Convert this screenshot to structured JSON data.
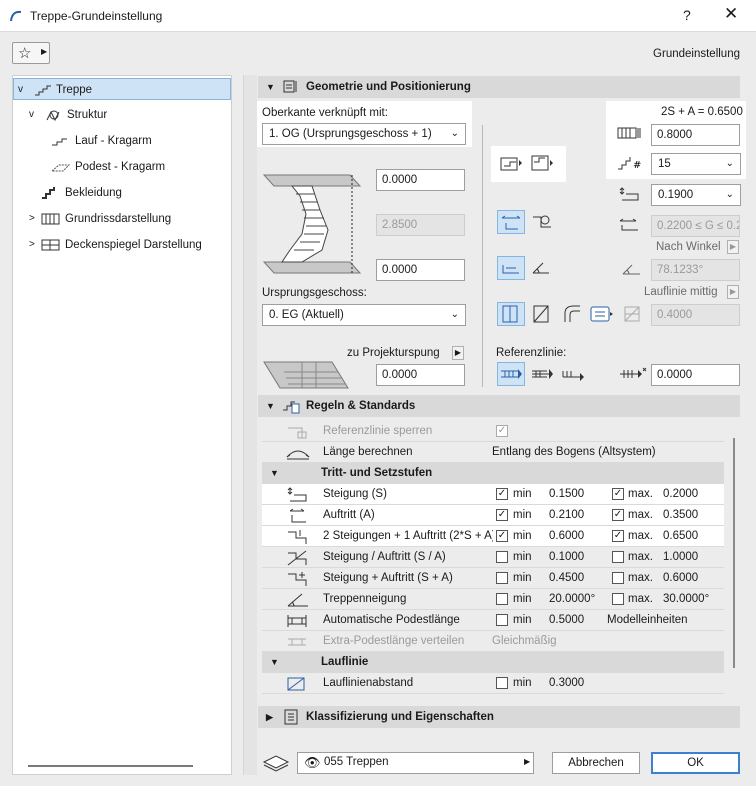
{
  "window": {
    "title": "Treppe-Grundeinstellung",
    "help": "?",
    "close": "✕"
  },
  "header": {
    "right_label": "Grundeinstellung"
  },
  "tree": [
    {
      "label": "Treppe",
      "expanded": "v",
      "icon": "stair-icon"
    },
    {
      "label": "Struktur",
      "expanded": "v",
      "icon": "structure-icon"
    },
    {
      "label": "Lauf - Kragarm",
      "icon": "flight-icon"
    },
    {
      "label": "Podest - Kragarm",
      "icon": "landing-icon"
    },
    {
      "label": "Bekleidung",
      "icon": "finish-icon"
    },
    {
      "label": "Grundrissdarstellung",
      "expanded": ">",
      "icon": "floorplan-icon"
    },
    {
      "label": "Deckenspiegel Darstellung",
      "expanded": ">",
      "icon": "ceiling-icon"
    }
  ],
  "geometry": {
    "title": "Geometrie und Positionierung",
    "top_link_label": "Oberkante verknüpft mit:",
    "top_link_value": "1. OG (Ursprungsgeschoss + 1)",
    "top_offset": "0.0000",
    "height": "2.8500",
    "bottom_offset": "0.0000",
    "home_story_label": "Ursprungsgeschoss:",
    "home_story_value": "0. EG (Aktuell)",
    "project_zero_label": "zu Projekturspung",
    "project_zero_value": "0.0000",
    "formula": "2S + A = 0.6500",
    "width": "0.8000",
    "num_risers": "15",
    "riser_height": "0.1900",
    "tread_range": "0.2200 ≤ G ≤ 0.2",
    "by_angle_label": "Nach Winkel",
    "angle": "78.1233°",
    "walkline_label": "Lauflinie mittig",
    "walkline_offset": "0.4000",
    "refline_label": "Referenzlinie:",
    "refline_offset": "0.0000"
  },
  "rules": {
    "title": "Regeln & Standards",
    "rows_top": [
      {
        "name": "Referenzlinie sperren",
        "checked": "✓",
        "disabled": true
      },
      {
        "name": "Länge berechnen",
        "value": "Entlang des Bogens (Altsystem)"
      }
    ],
    "subhead1": "Tritt- und Setzstufen",
    "rows": [
      {
        "name": "Steigung (S)",
        "cb1": "✓",
        "min_label": "min",
        "v1": "0.1500",
        "cb2": "✓",
        "max_label": "max.",
        "v2": "0.2000",
        "white": true
      },
      {
        "name": "Auftritt (A)",
        "cb1": "✓",
        "min_label": "min",
        "v1": "0.2100",
        "cb2": "✓",
        "max_label": "max.",
        "v2": "0.3500",
        "white": true
      },
      {
        "name": "2 Steigungen + 1 Auftritt (2*S + A)",
        "cb1": "✓",
        "min_label": "min",
        "v1": "0.6000",
        "cb2": "✓",
        "max_label": "max.",
        "v2": "0.6500",
        "white": true
      },
      {
        "name": "Steigung / Auftritt (S / A)",
        "cb1": "",
        "min_label": "min",
        "v1": "0.1000",
        "cb2": "",
        "max_label": "max.",
        "v2": "1.0000"
      },
      {
        "name": "Steigung + Auftritt (S + A)",
        "cb1": "",
        "min_label": "min",
        "v1": "0.4500",
        "cb2": "",
        "max_label": "max.",
        "v2": "0.6000"
      },
      {
        "name": "Treppenneigung",
        "cb1": "",
        "min_label": "min",
        "v1": "20.0000°",
        "cb2": "",
        "max_label": "max.",
        "v2": "30.0000°"
      },
      {
        "name": "Automatische Podestlänge",
        "cb1": "",
        "min_label": "min",
        "v1": "0.5000",
        "extra": "Modelleinheiten"
      },
      {
        "name": "Extra-Podestlänge verteilen",
        "extra_mid": "Gleichmäßig",
        "disabled": true
      }
    ],
    "subhead2": "Lauflinie",
    "rows2": [
      {
        "name": "Lauflinienabstand",
        "cb1": "",
        "min_label": "min",
        "v1": "0.3000"
      }
    ]
  },
  "classification": {
    "title": "Klassifizierung und Eigenschaften"
  },
  "footer": {
    "layer": "055 Treppen",
    "cancel": "Abbrechen",
    "ok": "OK"
  },
  "colors": {
    "accent": "#3d7fd1",
    "selection": "#cfe3f7",
    "header": "#d9d9d9"
  }
}
